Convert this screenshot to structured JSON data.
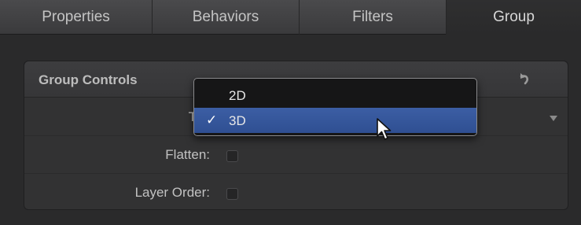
{
  "tabs": [
    {
      "label": "Properties"
    },
    {
      "label": "Behaviors"
    },
    {
      "label": "Filters"
    },
    {
      "label": "Group"
    }
  ],
  "panel": {
    "title": "Group Controls",
    "rows": [
      {
        "label": "Typ"
      },
      {
        "label": "Flatten:"
      },
      {
        "label": "Layer Order:"
      }
    ]
  },
  "menu": {
    "options": [
      {
        "label": "2D",
        "checked": false
      },
      {
        "label": "3D",
        "checked": true,
        "check_mark": "✓"
      }
    ]
  },
  "colors": {
    "highlight": "#3c5ea4",
    "background": "#2a2a2b"
  }
}
